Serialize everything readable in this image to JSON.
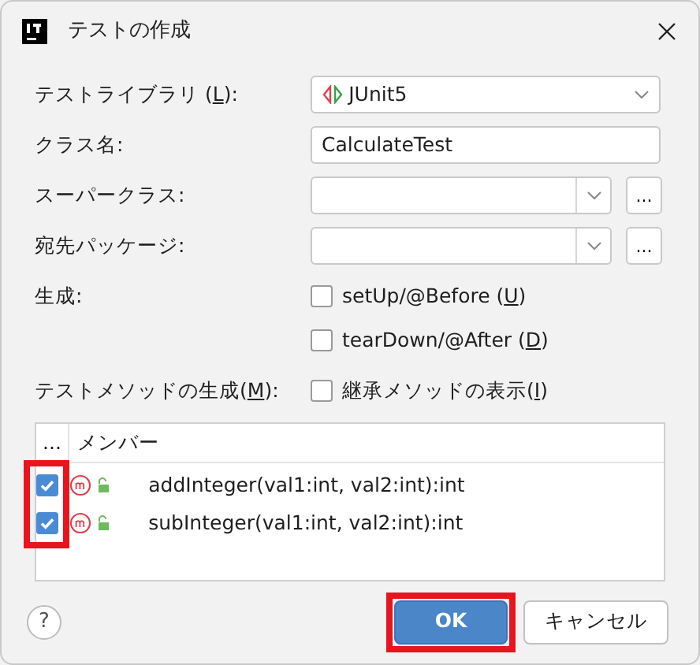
{
  "window": {
    "title": "テストの作成"
  },
  "fields": [
    {
      "kind": "combo",
      "label": {
        "before": "テストライブラリ (",
        "key": "L",
        "after": "):"
      },
      "value": "JUnit5"
    },
    {
      "kind": "text",
      "label": {
        "before": "クラス名:"
      },
      "value": "CalculateTest"
    },
    {
      "kind": "browse",
      "label": {
        "before": "スーパークラス:"
      },
      "browse": "..."
    },
    {
      "kind": "browse",
      "label": {
        "before": "宛先パッケージ:"
      },
      "browse": "..."
    }
  ],
  "generate": {
    "label": {
      "before": "生成:"
    },
    "options": [
      {
        "label": {
          "before": "setUp/@Before (",
          "key": "U",
          "after": ")"
        },
        "checked": false
      },
      {
        "label": {
          "before": "tearDown/@After (",
          "key": "D",
          "after": ")"
        },
        "checked": false
      }
    ]
  },
  "methods": {
    "label": {
      "before": "テストメソッドの生成(",
      "key": "M",
      "after": "):"
    },
    "inherited": {
      "label": {
        "before": "継承メソッドの表示(",
        "key": "I",
        "after": ")"
      },
      "checked": false
    }
  },
  "table": {
    "columns": [
      "...",
      "メンバー"
    ],
    "highlight_checkboxes": true,
    "rows": [
      {
        "checked": true,
        "signature": "addInteger(val1:int, val2:int):int"
      },
      {
        "checked": true,
        "signature": "subInteger(val1:int, val2:int):int"
      }
    ]
  },
  "help": "?",
  "buttons": [
    {
      "label": "OK",
      "primary": true,
      "highlighted": true
    },
    {
      "label": "キャンセル",
      "primary": false,
      "highlighted": false
    }
  ]
}
